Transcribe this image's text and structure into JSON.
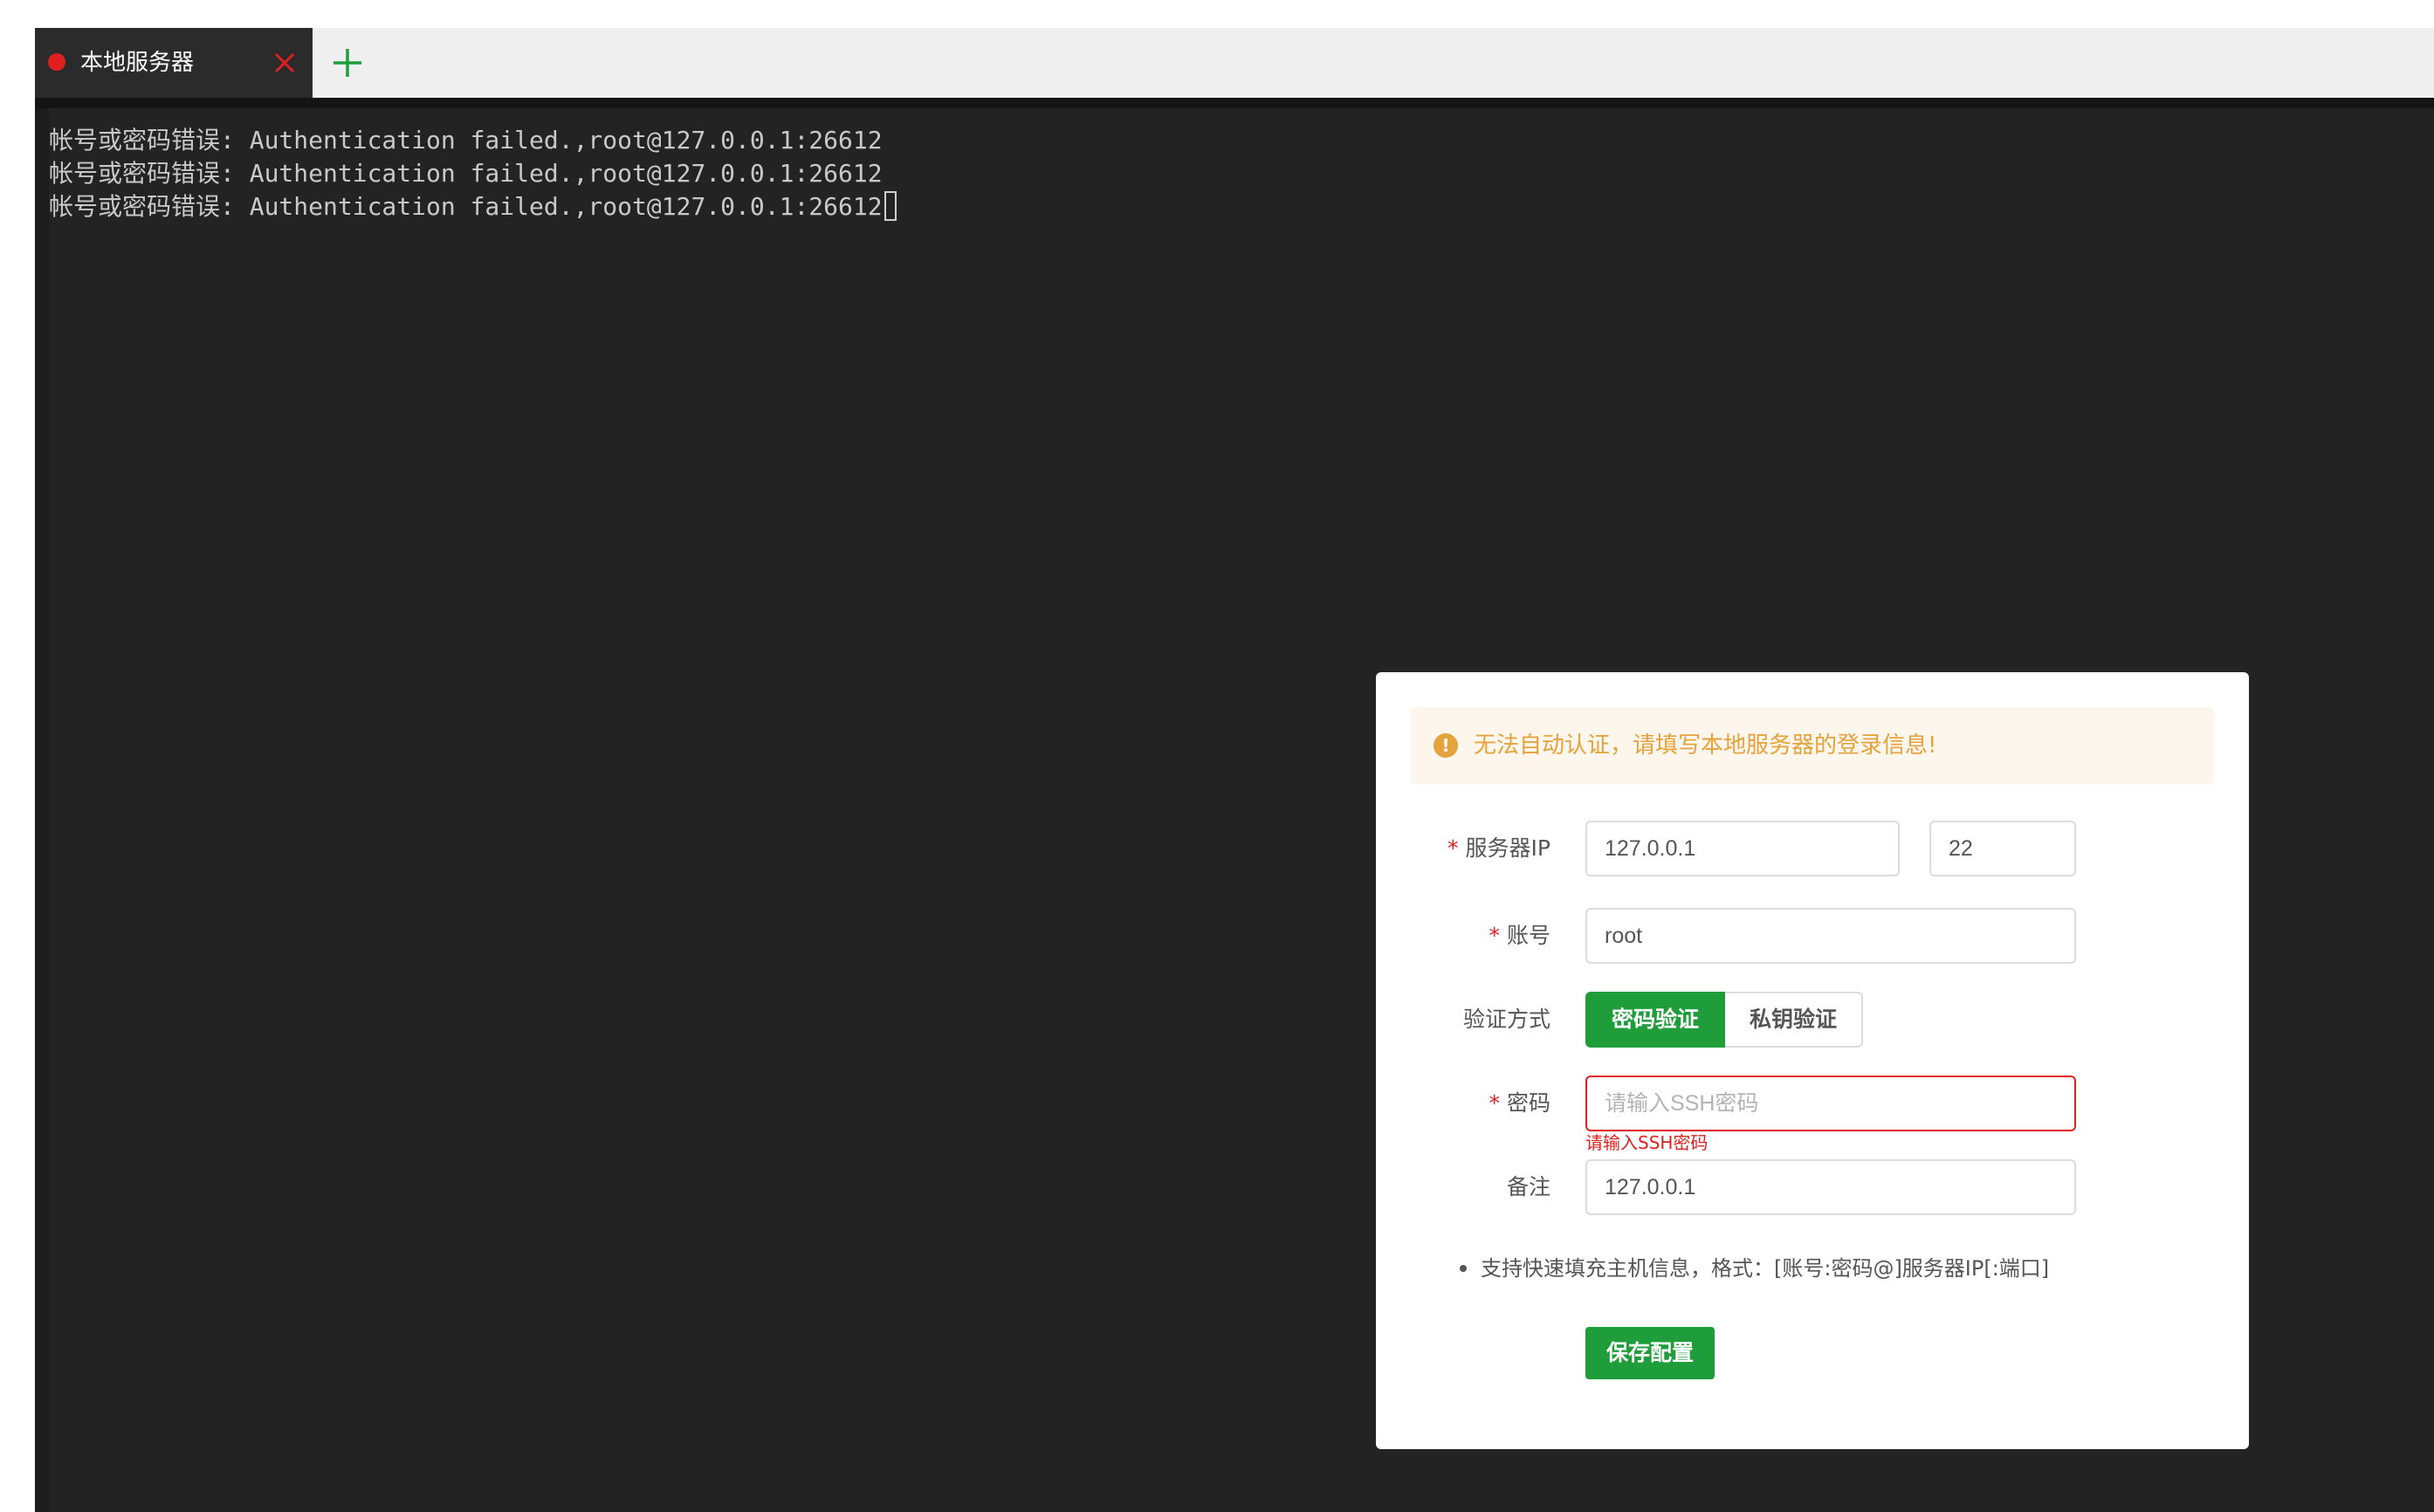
{
  "tabs": [
    {
      "label": "本地服务器",
      "status_color": "#e02020",
      "close_icon": "close-icon"
    }
  ],
  "add_tab_icon": "plus-icon",
  "terminal": {
    "lines": [
      "帐号或密码错误: Authentication failed.,root@127.0.0.1:26612",
      "帐号或密码错误: Authentication failed.,root@127.0.0.1:26612",
      "帐号或密码错误: Authentication failed.,root@127.0.0.1:26612"
    ]
  },
  "dialog": {
    "alert": {
      "icon": "warning-icon",
      "glyph": "!",
      "text": "无法自动认证，请填写本地服务器的登录信息!"
    },
    "required_mark": "*",
    "server_ip": {
      "label": "服务器IP",
      "value": "127.0.0.1",
      "port": "22"
    },
    "account": {
      "label": "账号",
      "value": "root"
    },
    "auth_method": {
      "label": "验证方式",
      "options": [
        "密码验证",
        "私钥验证"
      ],
      "selected": "密码验证"
    },
    "password": {
      "label": "密码",
      "value": "",
      "placeholder": "请输入SSH密码",
      "error": "请输入SSH密码"
    },
    "remark": {
      "label": "备注",
      "value": "127.0.0.1"
    },
    "tip": "支持快速填充主机信息，格式：[账号:密码@]服务器IP[:端口]",
    "save_label": "保存配置"
  },
  "colors": {
    "accent": "#1f9d3a",
    "error": "#e02020",
    "warning": "#e6a23c",
    "terminal_bg": "#232323"
  }
}
